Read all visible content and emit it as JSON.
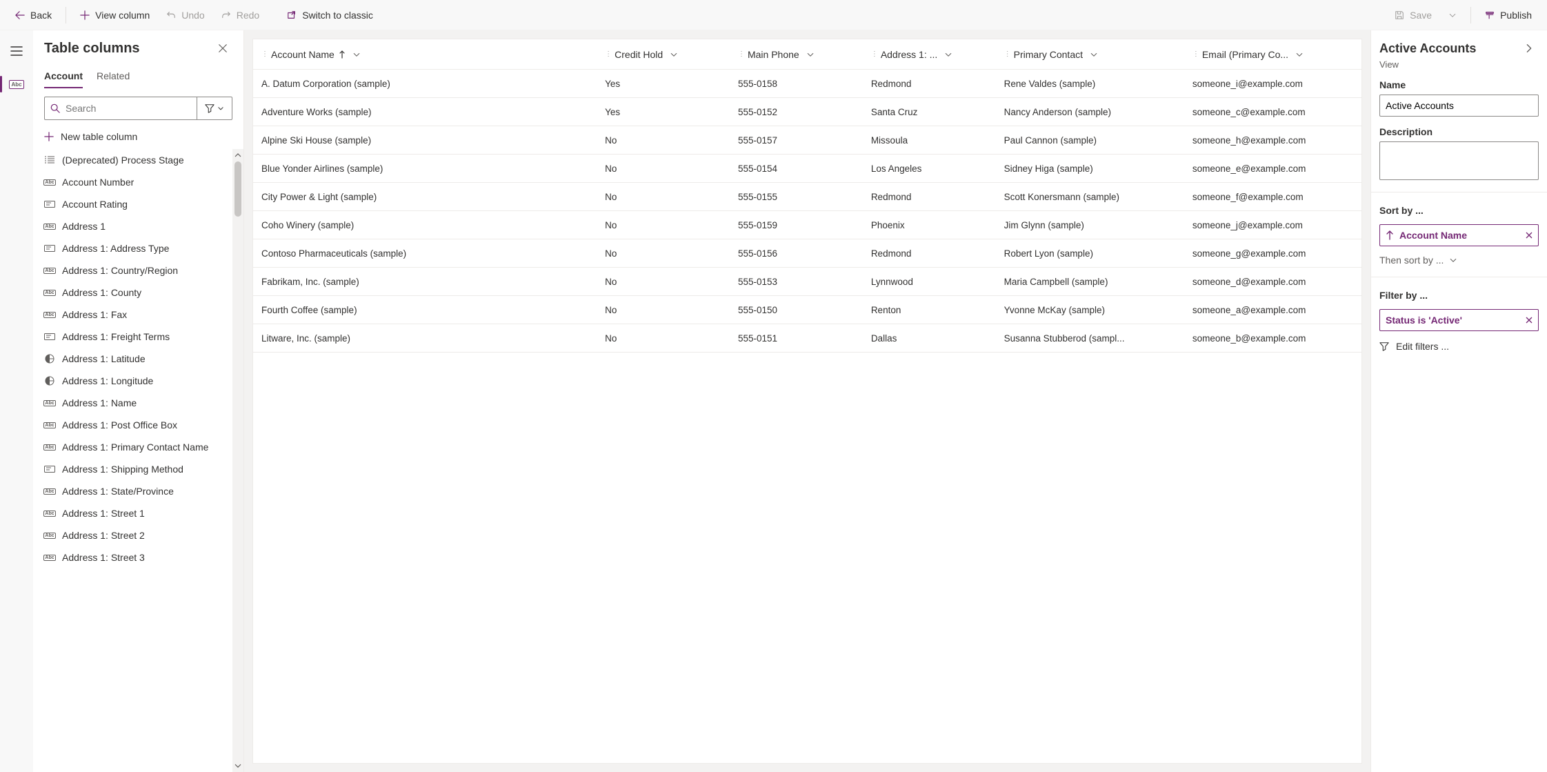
{
  "toolbar": {
    "back": "Back",
    "viewcol": "View column",
    "undo": "Undo",
    "redo": "Redo",
    "switch": "Switch to classic",
    "save": "Save",
    "publish": "Publish"
  },
  "leftPanel": {
    "title": "Table columns",
    "tabs": {
      "account": "Account",
      "related": "Related"
    },
    "searchPlaceholder": "Search",
    "newColumn": "New table column",
    "items": [
      "(Deprecated) Process Stage",
      "Account Number",
      "Account Rating",
      "Address 1",
      "Address 1: Address Type",
      "Address 1: Country/Region",
      "Address 1: County",
      "Address 1: Fax",
      "Address 1: Freight Terms",
      "Address 1: Latitude",
      "Address 1: Longitude",
      "Address 1: Name",
      "Address 1: Post Office Box",
      "Address 1: Primary Contact Name",
      "Address 1: Shipping Method",
      "Address 1: State/Province",
      "Address 1: Street 1",
      "Address 1: Street 2",
      "Address 1: Street 3"
    ],
    "itemIcons": [
      "list",
      "abc",
      "opt",
      "abc",
      "opt",
      "abc",
      "abc",
      "abc",
      "opt",
      "globe",
      "globe",
      "abc",
      "abc",
      "abc",
      "opt",
      "abc",
      "abc",
      "abc",
      "abc"
    ]
  },
  "grid": {
    "columns": [
      "Account Name",
      "Credit Hold",
      "Main Phone",
      "Address 1: ...",
      "Primary Contact",
      "Email (Primary Co..."
    ],
    "sortedCol": 0,
    "rows": [
      [
        "A. Datum Corporation (sample)",
        "Yes",
        "555-0158",
        "Redmond",
        "Rene Valdes (sample)",
        "someone_i@example.com"
      ],
      [
        "Adventure Works (sample)",
        "Yes",
        "555-0152",
        "Santa Cruz",
        "Nancy Anderson (sample)",
        "someone_c@example.com"
      ],
      [
        "Alpine Ski House (sample)",
        "No",
        "555-0157",
        "Missoula",
        "Paul Cannon (sample)",
        "someone_h@example.com"
      ],
      [
        "Blue Yonder Airlines (sample)",
        "No",
        "555-0154",
        "Los Angeles",
        "Sidney Higa (sample)",
        "someone_e@example.com"
      ],
      [
        "City Power & Light (sample)",
        "No",
        "555-0155",
        "Redmond",
        "Scott Konersmann (sample)",
        "someone_f@example.com"
      ],
      [
        "Coho Winery (sample)",
        "No",
        "555-0159",
        "Phoenix",
        "Jim Glynn (sample)",
        "someone_j@example.com"
      ],
      [
        "Contoso Pharmaceuticals (sample)",
        "No",
        "555-0156",
        "Redmond",
        "Robert Lyon (sample)",
        "someone_g@example.com"
      ],
      [
        "Fabrikam, Inc. (sample)",
        "No",
        "555-0153",
        "Lynnwood",
        "Maria Campbell (sample)",
        "someone_d@example.com"
      ],
      [
        "Fourth Coffee (sample)",
        "No",
        "555-0150",
        "Renton",
        "Yvonne McKay (sample)",
        "someone_a@example.com"
      ],
      [
        "Litware, Inc. (sample)",
        "No",
        "555-0151",
        "Dallas",
        "Susanna Stubberod (sampl...",
        "someone_b@example.com"
      ]
    ]
  },
  "rightPanel": {
    "title": "Active Accounts",
    "sub": "View",
    "nameLabel": "Name",
    "nameValue": "Active Accounts",
    "descLabel": "Description",
    "descValue": "",
    "sortByLabel": "Sort by ...",
    "sortChip": "Account Name",
    "thenBy": "Then sort by ...",
    "filterByLabel": "Filter by ...",
    "filterChip": "Status is 'Active'",
    "editFilters": "Edit filters ..."
  }
}
